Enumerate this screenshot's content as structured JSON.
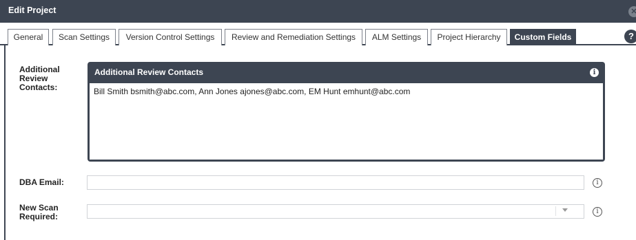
{
  "window": {
    "title": "Edit Project",
    "close_icon": "close-icon",
    "help_label": "?"
  },
  "tabs": [
    {
      "label": "General",
      "active": false
    },
    {
      "label": "Scan Settings",
      "active": false
    },
    {
      "label": "Version Control Settings",
      "active": false
    },
    {
      "label": "Review and Remediation Settings",
      "active": false
    },
    {
      "label": "ALM Settings",
      "active": false
    },
    {
      "label": "Project Hierarchy",
      "active": false
    },
    {
      "label": "Custom Fields",
      "active": true
    }
  ],
  "form": {
    "contacts": {
      "label_line1": "Additional",
      "label_line2": "Review",
      "label_line3": "Contacts:",
      "panel_title": "Additional Review Contacts",
      "info_glyph": "i",
      "value": "Bill Smith bsmith@abc.com, Ann Jones ajones@abc.com, EM Hunt emhunt@abc.com"
    },
    "dba_email": {
      "label": "DBA Email:",
      "value": "",
      "info_glyph": "i"
    },
    "new_scan": {
      "label_line1": "New Scan",
      "label_line2": "Required:",
      "selected": "",
      "info_glyph": "i"
    }
  },
  "colors": {
    "header_bg": "#3d4552",
    "tab_border": "#7c818a",
    "input_border": "#d0d3d7"
  }
}
